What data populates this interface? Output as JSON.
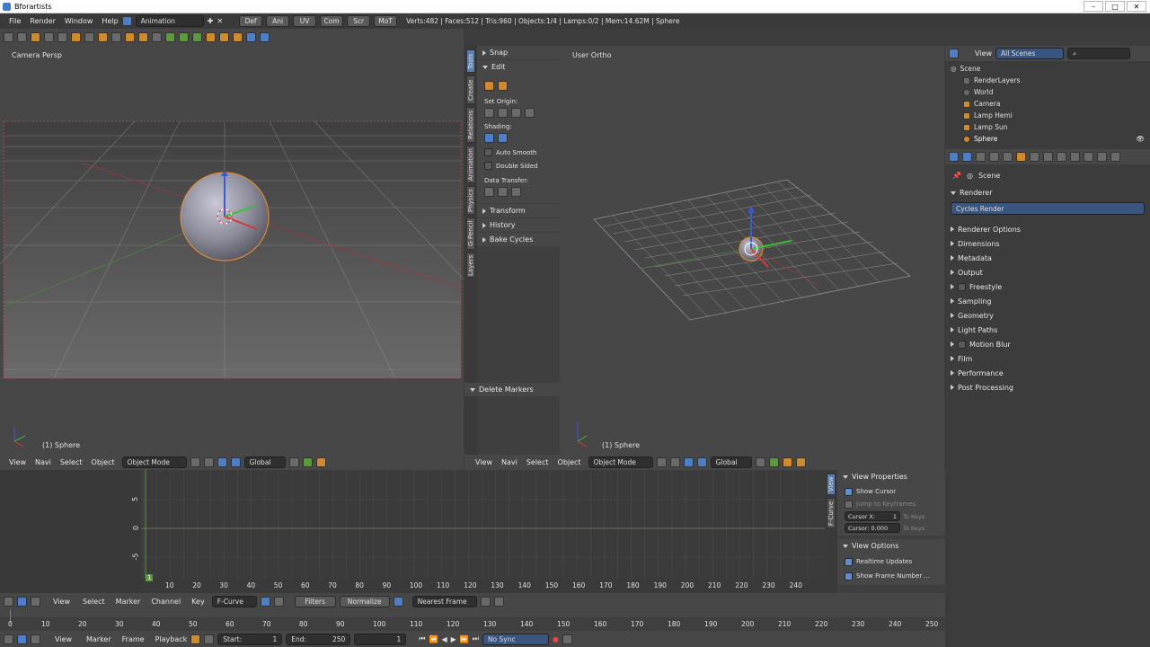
{
  "window": {
    "title": "Bforartists"
  },
  "topbar": {
    "menus": [
      "File",
      "Render",
      "Window",
      "Help"
    ],
    "layout": "Animation",
    "tabs": [
      "Def",
      "Ani",
      "UV",
      "Com",
      "Scr",
      "MoT"
    ],
    "stats": "Verts:482 | Faces:512 | Tris:960 | Objects:1/4 | Lamps:0/2 | Mem:14.62M | Sphere"
  },
  "viewport_left": {
    "label": "Camera Persp",
    "object": "(1) Sphere",
    "menus": [
      "View",
      "Navi",
      "Select",
      "Object"
    ],
    "mode": "Object Mode",
    "orientation": "Global"
  },
  "viewport_right": {
    "label": "User Ortho",
    "object": "(1) Sphere",
    "menus": [
      "View",
      "Navi",
      "Select",
      "Object"
    ],
    "mode": "Object Mode",
    "orientation": "Global"
  },
  "tools": {
    "tabs": [
      "Tools",
      "Create",
      "Relations",
      "Animation",
      "Physics",
      "G-Pencil",
      "Layers"
    ],
    "snap": "Snap",
    "edit": "Edit",
    "set_origin": "Set Origin:",
    "shading": "Shading:",
    "auto_smooth": "Auto Smooth",
    "double_sided": "Double Sided",
    "data_transfer": "Data Transfer:",
    "transform": "Transform",
    "history": "History",
    "bake": "Bake Cycles",
    "delete_markers": "Delete Markers"
  },
  "outliner": {
    "view": "View",
    "scenes": "All Scenes",
    "items": [
      "Scene",
      "RenderLayers",
      "World",
      "Camera",
      "Lamp Hemi",
      "Lamp Sun",
      "Sphere"
    ]
  },
  "properties": {
    "scene": "Scene",
    "renderer_header": "Renderer",
    "engine": "Cycles Render",
    "sections": [
      "Renderer Options",
      "Dimensions",
      "Metadata",
      "Output",
      "Freestyle",
      "Sampling",
      "Geometry",
      "Light Paths",
      "Motion Blur",
      "Film",
      "Performance",
      "Post Processing"
    ]
  },
  "graph": {
    "y_labels": [
      "5",
      "0",
      "-5"
    ],
    "frame": "1",
    "x_ticks": [
      "10",
      "20",
      "30",
      "40",
      "50",
      "60",
      "70",
      "80",
      "90",
      "100",
      "110",
      "120",
      "130",
      "140",
      "150",
      "160",
      "170",
      "180",
      "190",
      "200",
      "210",
      "220",
      "230",
      "240"
    ],
    "side_tabs": [
      "View",
      "F-Curve"
    ],
    "view_properties": "View Properties",
    "show_cursor": "Show Cursor",
    "jump": "Jump to Keyframes",
    "cursor_x": "Cursor X:",
    "cursor_x_val": "1",
    "cursor_y": "Cursor: 0.000",
    "to_keys": "To Keys",
    "view_options": "View Options",
    "realtime": "Realtime Updates",
    "show_frame": "Show Frame Number ...",
    "menus": [
      "View",
      "Select",
      "Marker",
      "Channel",
      "Key"
    ],
    "mode": "F-Curve",
    "filters": "Filters",
    "normalize": "Normalize",
    "nearest": "Nearest Frame"
  },
  "timeline": {
    "ticks": [
      "0",
      "10",
      "20",
      "30",
      "40",
      "50",
      "60",
      "70",
      "80",
      "90",
      "100",
      "110",
      "120",
      "130",
      "140",
      "150",
      "160",
      "170",
      "180",
      "190",
      "200",
      "210",
      "220",
      "230",
      "240",
      "250"
    ],
    "menus": [
      "View",
      "Marker",
      "Frame",
      "Playback"
    ],
    "start": "Start:",
    "start_val": "1",
    "end": "End:",
    "end_val": "250",
    "current": "1",
    "sync": "No Sync"
  }
}
